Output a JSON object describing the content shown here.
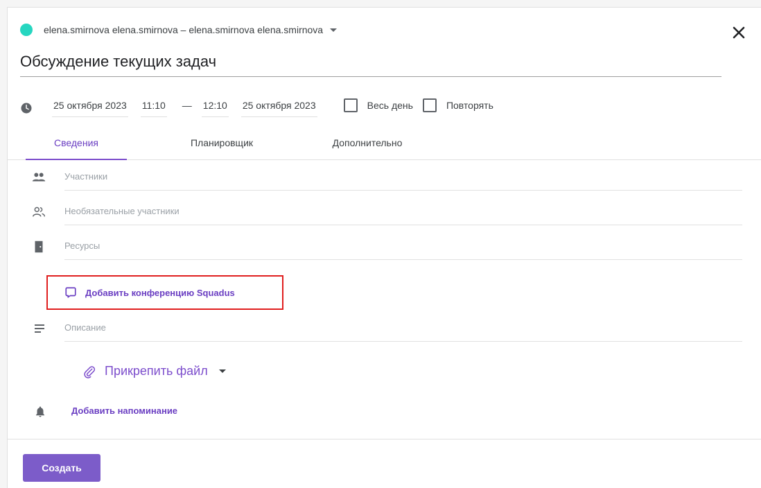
{
  "header": {
    "account": "elena.smirnova elena.smirnova – elena.smirnova elena.smirnova",
    "status_color": "#26d6c0",
    "close_icon": "close-icon"
  },
  "event": {
    "title": "Обсуждение текущих задач"
  },
  "datetime": {
    "start_date": "25 октября 2023",
    "start_time": "11:10",
    "separator": "—",
    "end_time": "12:10",
    "end_date": "25 октября 2023",
    "all_day_label": "Весь день",
    "all_day_checked": false,
    "repeat_label": "Повторять",
    "repeat_checked": false
  },
  "tabs": [
    {
      "label": "Сведения",
      "active": true
    },
    {
      "label": "Планировщик",
      "active": false
    },
    {
      "label": "Дополнительно",
      "active": false
    }
  ],
  "form": {
    "participants_placeholder": "Участники",
    "optional_participants_placeholder": "Необязательные участники",
    "resources_placeholder": "Ресурсы",
    "add_conference_label": "Добавить конференцию Squadus",
    "description_placeholder": "Описание",
    "attach_file_label": "Прикрепить файл",
    "add_reminder_label": "Добавить напоминание"
  },
  "footer": {
    "create_label": "Создать"
  },
  "colors": {
    "accent": "#7c4dcc",
    "button": "#7c5cc9",
    "highlight_box": "#e01e1e"
  }
}
